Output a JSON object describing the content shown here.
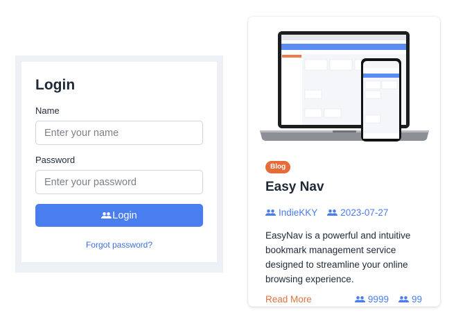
{
  "login": {
    "title": "Login",
    "name_label": "Name",
    "name_placeholder": "Enter your name",
    "password_label": "Password",
    "password_placeholder": "Enter your password",
    "button_label": "Login",
    "forgot_link": "Forgot password?"
  },
  "blog": {
    "badge": "Blog",
    "title": "Easy Nav",
    "author": "IndieKKY",
    "date": "2023-07-27",
    "description": "EasyNav is a powerful and intuitive bookmark management service designed to streamline your online browsing experience.",
    "read_more": "Read More",
    "views": "9999",
    "likes": "99"
  },
  "colors": {
    "primary": "#4a7df0",
    "badge": "#e66b38",
    "read_more": "#e0733f"
  }
}
